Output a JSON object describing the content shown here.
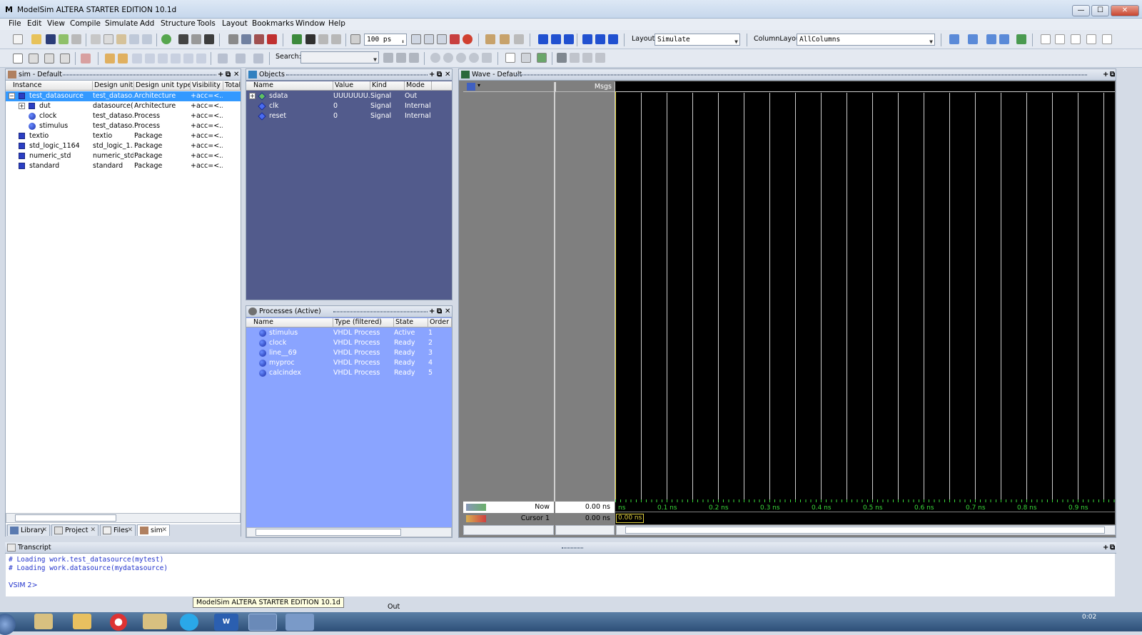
{
  "window": {
    "title": "ModelSim ALTERA STARTER EDITION 10.1d",
    "min": "—",
    "max": "☐",
    "close": "✕"
  },
  "menu": [
    "File",
    "Edit",
    "View",
    "Compile",
    "Simulate",
    "Add",
    "Structure",
    "Tools",
    "Layout",
    "Bookmarks",
    "Window",
    "Help"
  ],
  "toolbar": {
    "run_length": "100 ps",
    "layout_label": "Layout",
    "layout_value": "Simulate",
    "column_layout_label": "ColumnLayout",
    "column_layout_value": "AllColumns",
    "search_label": "Search:",
    "search_value": ""
  },
  "sim_pane": {
    "title": "sim - Default",
    "columns": [
      "Instance",
      "Design unit",
      "Design unit type",
      "Visibility",
      "Total c"
    ],
    "rows": [
      {
        "name": "test_datasource",
        "unit": "test_dataso…",
        "type": "Architecture",
        "vis": "+acc=<…",
        "selected": true
      },
      {
        "name": "dut",
        "unit": "datasource(…",
        "type": "Architecture",
        "vis": "+acc=<…"
      },
      {
        "name": "clock",
        "unit": "test_dataso…",
        "type": "Process",
        "vis": "+acc=<…"
      },
      {
        "name": "stimulus",
        "unit": "test_dataso…",
        "type": "Process",
        "vis": "+acc=<…"
      },
      {
        "name": "textio",
        "unit": "textio",
        "type": "Package",
        "vis": "+acc=<…"
      },
      {
        "name": "std_logic_1164",
        "unit": "std_logic_1…",
        "type": "Package",
        "vis": "+acc=<…"
      },
      {
        "name": "numeric_std",
        "unit": "numeric_std",
        "type": "Package",
        "vis": "+acc=<…"
      },
      {
        "name": "standard",
        "unit": "standard",
        "type": "Package",
        "vis": "+acc=<…"
      }
    ],
    "tabs": [
      "Library",
      "Project",
      "Files",
      "sim"
    ]
  },
  "objects_pane": {
    "title": "Objects",
    "columns": [
      "Name",
      "Value",
      "Kind",
      "Mode"
    ],
    "rows": [
      {
        "name": "sdata",
        "value": "UUUUUUU…",
        "kind": "Signal",
        "mode": "Out"
      },
      {
        "name": "clk",
        "value": "0",
        "kind": "Signal",
        "mode": "Internal"
      },
      {
        "name": "reset",
        "value": "0",
        "kind": "Signal",
        "mode": "Internal"
      }
    ]
  },
  "processes_pane": {
    "title": "Processes (Active)",
    "columns": [
      "Name",
      "Type (filtered)",
      "State",
      "Order"
    ],
    "rows": [
      {
        "name": "stimulus",
        "type": "VHDL Process",
        "state": "Active",
        "order": "1"
      },
      {
        "name": "clock",
        "type": "VHDL Process",
        "state": "Ready",
        "order": "2"
      },
      {
        "name": "line__69",
        "type": "VHDL Process",
        "state": "Ready",
        "order": "3"
      },
      {
        "name": "myproc",
        "type": "VHDL Process",
        "state": "Ready",
        "order": "4"
      },
      {
        "name": "calcindex",
        "type": "VHDL Process",
        "state": "Ready",
        "order": "5"
      }
    ]
  },
  "wave_pane": {
    "title": "Wave - Default",
    "msgs_label": "Msgs",
    "now_label": "Now",
    "now_value": "0.00 ns",
    "cursor_label": "Cursor 1",
    "cursor_value": "0.00 ns",
    "cursor_flag": "0.00 ns",
    "ticks": [
      "ns",
      "0.1 ns",
      "0.2 ns",
      "0.3 ns",
      "0.4 ns",
      "0.5 ns",
      "0.6 ns",
      "0.7 ns",
      "0.8 ns",
      "0.9 ns"
    ]
  },
  "transcript": {
    "title": "Transcript",
    "lines": [
      "# Loading work.test_datasource(mytest)",
      "# Loading work.datasource(mydatasource)"
    ],
    "prompt": "VSIM 2>"
  },
  "status": {
    "tooltip": "ModelSim ALTERA STARTER EDITION 10.1d",
    "text": "Out"
  },
  "taskbar": {
    "clock": "0:02"
  }
}
